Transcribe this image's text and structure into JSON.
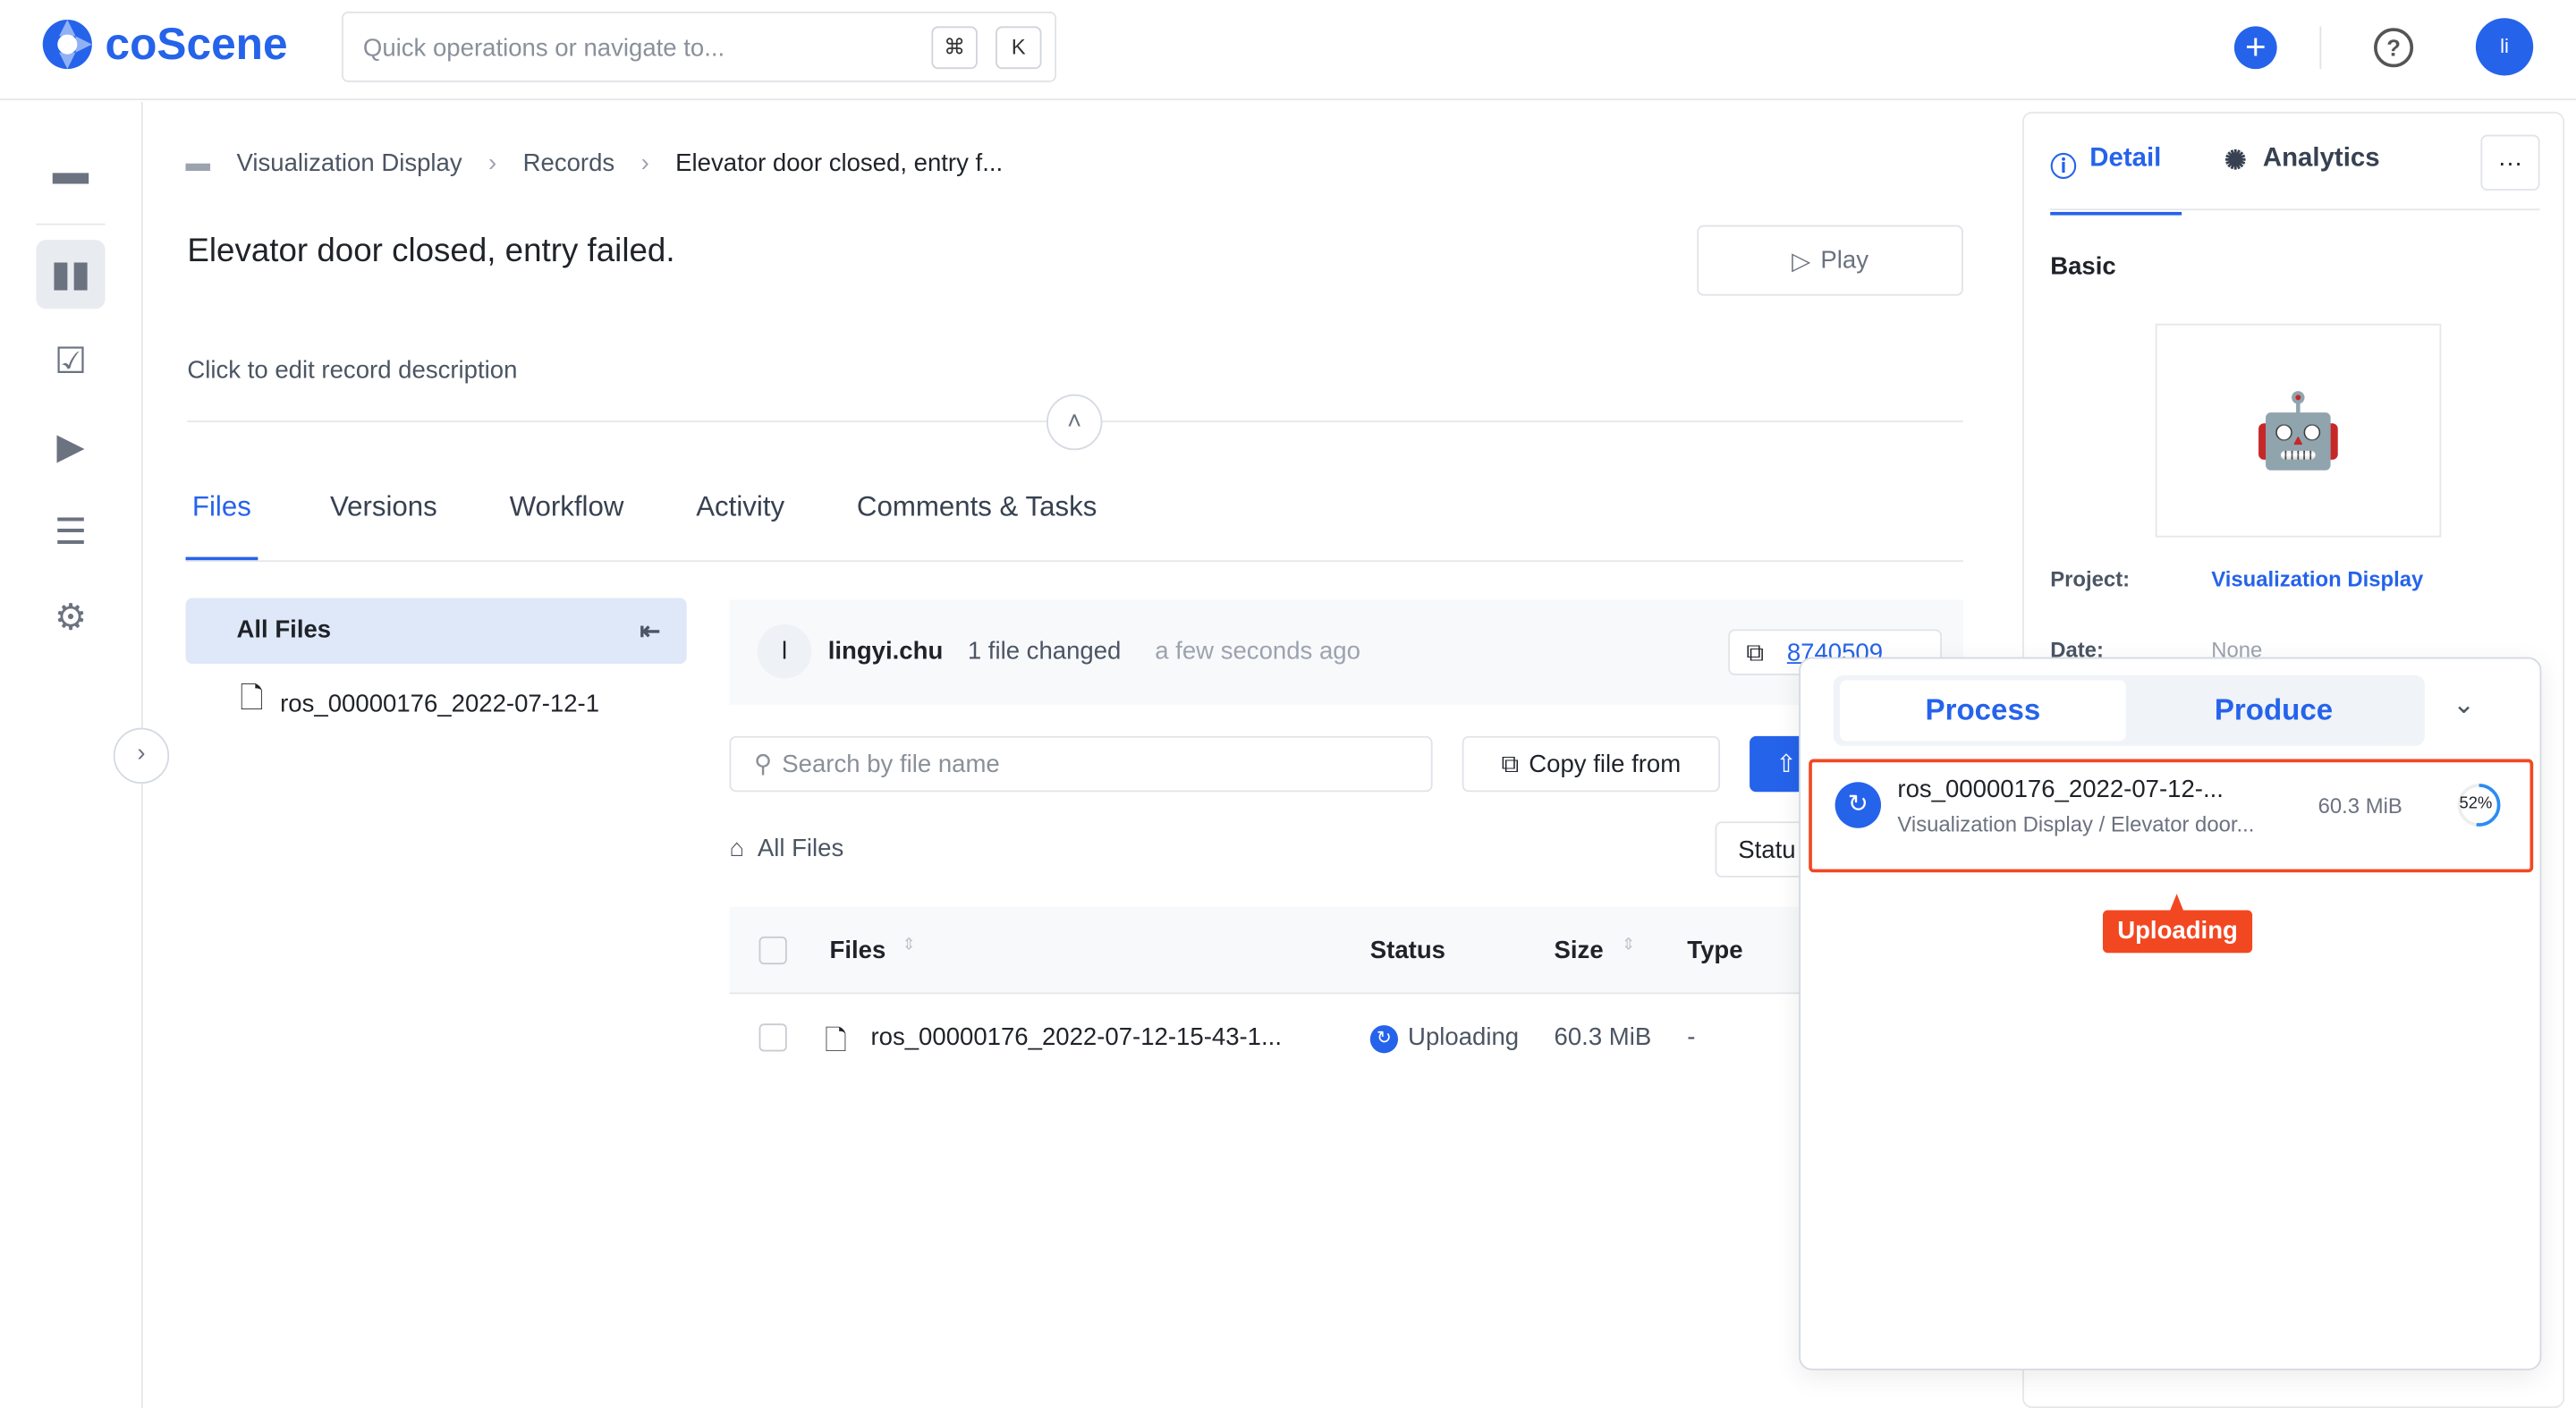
{
  "app": {
    "brand": "coScene",
    "search_placeholder": "Quick operations or navigate to...",
    "kbd_cmd": "⌘",
    "kbd_k": "K",
    "avatar": "li"
  },
  "breadcrumb": [
    "Visualization Display",
    "Records",
    "Elevator door closed, entry f..."
  ],
  "record": {
    "title": "Elevator door closed, entry failed.",
    "description": "Click to edit record description",
    "play": "Play"
  },
  "tabs": [
    "Files",
    "Versions",
    "Workflow",
    "Activity",
    "Comments & Tasks"
  ],
  "tree": {
    "root": "All Files",
    "file": "ros_00000176_2022-07-12-1"
  },
  "commit": {
    "avatar": "l",
    "user": "lingyi.chu",
    "changes": "1 file changed",
    "time": "a few seconds ago",
    "id": "8740509"
  },
  "toolbar": {
    "search_placeholder": "Search by file name",
    "copy": "Copy file from",
    "all_files": "All Files",
    "status_filter": "Statu"
  },
  "table": {
    "headers": [
      "Files",
      "Status",
      "Size",
      "Type"
    ],
    "rows": [
      {
        "name": "ros_00000176_2022-07-12-15-43-1...",
        "status": "Uploading",
        "size": "60.3 MiB",
        "type": "-"
      }
    ]
  },
  "panel": {
    "tabs": [
      "Detail",
      "Analytics"
    ],
    "section": "Basic",
    "project_label": "Project:",
    "project": "Visualization Display",
    "date_label": "Date:",
    "date": "None"
  },
  "popup": {
    "tabs": [
      "Process",
      "Produce"
    ],
    "item": {
      "name": "ros_00000176_2022-07-12-...",
      "path": "Visualization Display / Elevator door...",
      "size": "60.3 MiB",
      "progress_label": "52%",
      "progress": 52
    },
    "tooltip": "Uploading"
  },
  "colors": {
    "accent": "#2563eb",
    "highlight": "#f24822"
  }
}
